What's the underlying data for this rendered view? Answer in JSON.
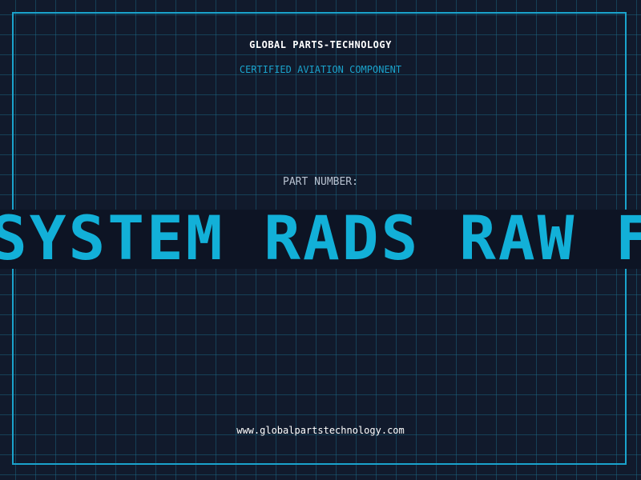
{
  "brand": {
    "name": "GLOBAL PARTS-TECHNOLOGY",
    "tagline": "CERTIFIED AVIATION COMPONENT"
  },
  "part": {
    "label": "PART NUMBER:",
    "value": "SYSTEM RADS RAW FO"
  },
  "footer": {
    "url": "www.globalpartstechnology.com"
  },
  "colors": {
    "background": "#111a2c",
    "accent": "#1aa3cc",
    "text": "#ffffff"
  }
}
